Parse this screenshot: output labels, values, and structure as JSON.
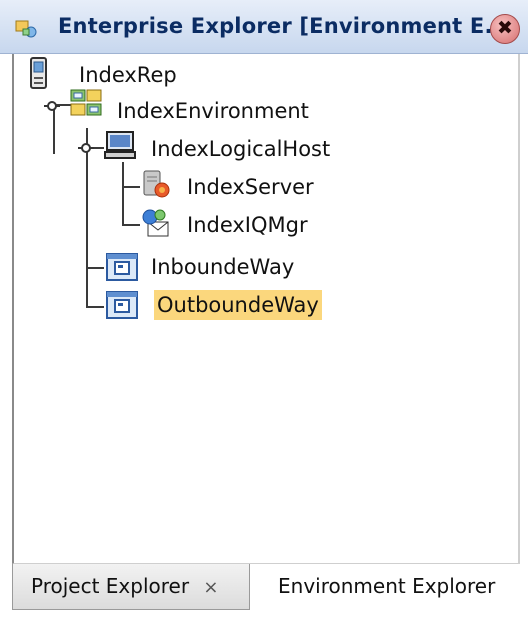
{
  "window": {
    "title": "Enterprise Explorer [Environment E...",
    "close_symbol": "✖"
  },
  "tree": {
    "nodes": [
      {
        "label": "IndexRep",
        "icon": "repository-icon"
      },
      {
        "label": "IndexEnvironment",
        "icon": "environment-icon"
      },
      {
        "label": "IndexLogicalHost",
        "icon": "logical-host-icon"
      },
      {
        "label": "IndexServer",
        "icon": "server-icon"
      },
      {
        "label": "IndexIQMgr",
        "icon": "iq-manager-icon"
      },
      {
        "label": "InboundeWay",
        "icon": "eway-icon"
      },
      {
        "label": "OutboundeWay",
        "icon": "eway-icon",
        "selected": true
      }
    ]
  },
  "tabs": {
    "project": "Project Explorer",
    "project_close": "×",
    "environment": "Environment Explorer"
  },
  "colors": {
    "selection": "#fbd77d",
    "title_text": "#0b2c63"
  }
}
